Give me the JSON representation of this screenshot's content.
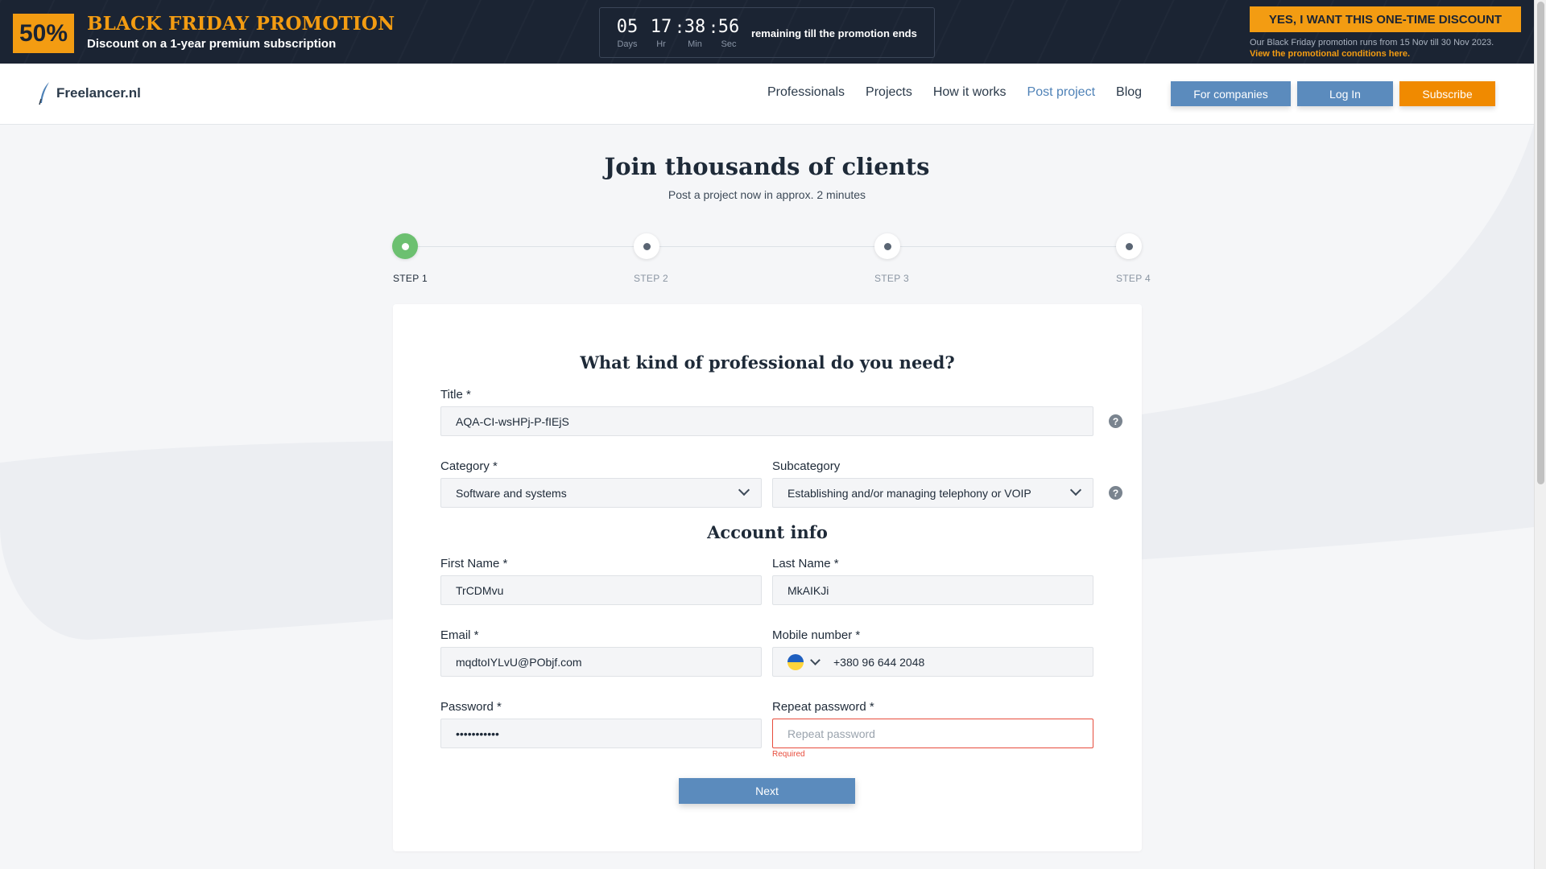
{
  "promo": {
    "badge": "50%",
    "title": "BLACK FRIDAY PROMOTION",
    "subtitle": "Discount on a 1-year premium subscription",
    "countdown": {
      "days": "05",
      "hours": "17",
      "minutes": "38",
      "seconds": "56",
      "days_label": "Days",
      "hours_label": "Hr",
      "minutes_label": "Min",
      "seconds_label": "Sec",
      "text": "remaining till the promotion ends"
    },
    "cta_label": "YES, I WANT THIS ONE-TIME DISCOUNT",
    "note": "Our Black Friday promotion runs from 15 Nov till 30 Nov 2023.",
    "link": "View the promotional conditions here."
  },
  "header": {
    "logo_text": "Freelancer.nl",
    "nav": [
      "Professionals",
      "Projects",
      "How it works",
      "Post project",
      "Blog"
    ],
    "active_nav": "Post project",
    "buttons": {
      "companies": "For companies",
      "login": "Log In",
      "subscribe": "Subscribe"
    }
  },
  "hero": {
    "title": "Join thousands of clients",
    "subtitle": "Post a project now in approx. 2 minutes"
  },
  "stepper": {
    "steps": [
      "STEP 1",
      "STEP 2",
      "STEP 3",
      "STEP 4"
    ],
    "active_step": 1
  },
  "form": {
    "section_title": "What kind of professional do you need?",
    "title_label": "Title *",
    "title_value": "AQA-CI-wsHPj-P-fIEjS",
    "category_label": "Category *",
    "category_value": "Software and systems",
    "subcategory_label": "Subcategory",
    "subcategory_value": "Establishing and/or managing telephony or VOIP",
    "account_title": "Account info",
    "first_name_label": "First Name *",
    "first_name_value": "TrCDMvu",
    "last_name_label": "Last Name *",
    "last_name_value": "MkAIKJi",
    "email_label": "Email *",
    "email_value": "mqdtoIYLvU@PObjf.com",
    "mobile_label": "Mobile number *",
    "mobile_value": "+380 96 644 2048",
    "password_label": "Password *",
    "password_value": "•••••••••••",
    "repeat_password_label": "Repeat password *",
    "repeat_password_placeholder": "Repeat password",
    "repeat_password_error": "Required",
    "help_glyph": "?",
    "next_label": "Next"
  },
  "colors": {
    "accent_orange": "#f39c12",
    "primary_blue": "#5b8bbd",
    "step_active_green": "#6cc070",
    "error_red": "#e74c3c",
    "banner_bg": "#1b2433"
  }
}
